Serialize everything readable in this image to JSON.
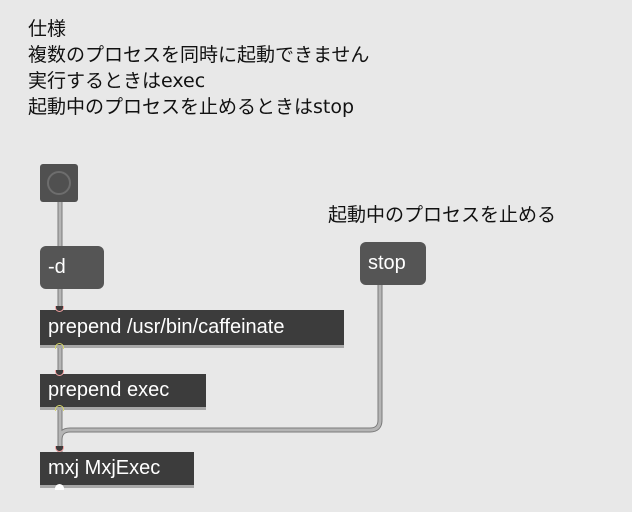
{
  "spec_comment": {
    "lines": [
      "仕様",
      "複数のプロセスを同時に起動できません",
      "実行するときはexec",
      "起動中のプロセスを止めるときはstop"
    ]
  },
  "stop_comment": "起動中のプロセスを止める",
  "messages": {
    "d_flag": "-d",
    "stop": "stop"
  },
  "objects": {
    "prepend_caffeinate": "prepend /usr/bin/caffeinate",
    "prepend_exec": "prepend exec",
    "mxj": "mxj MxjExec"
  },
  "colors": {
    "background": "#e8e8e8",
    "object": "#3c3c3c",
    "message": "#555555",
    "patchcord": "#a8a8a8",
    "inlet": "#f2a0a0",
    "outlet": "#d8d86a"
  }
}
